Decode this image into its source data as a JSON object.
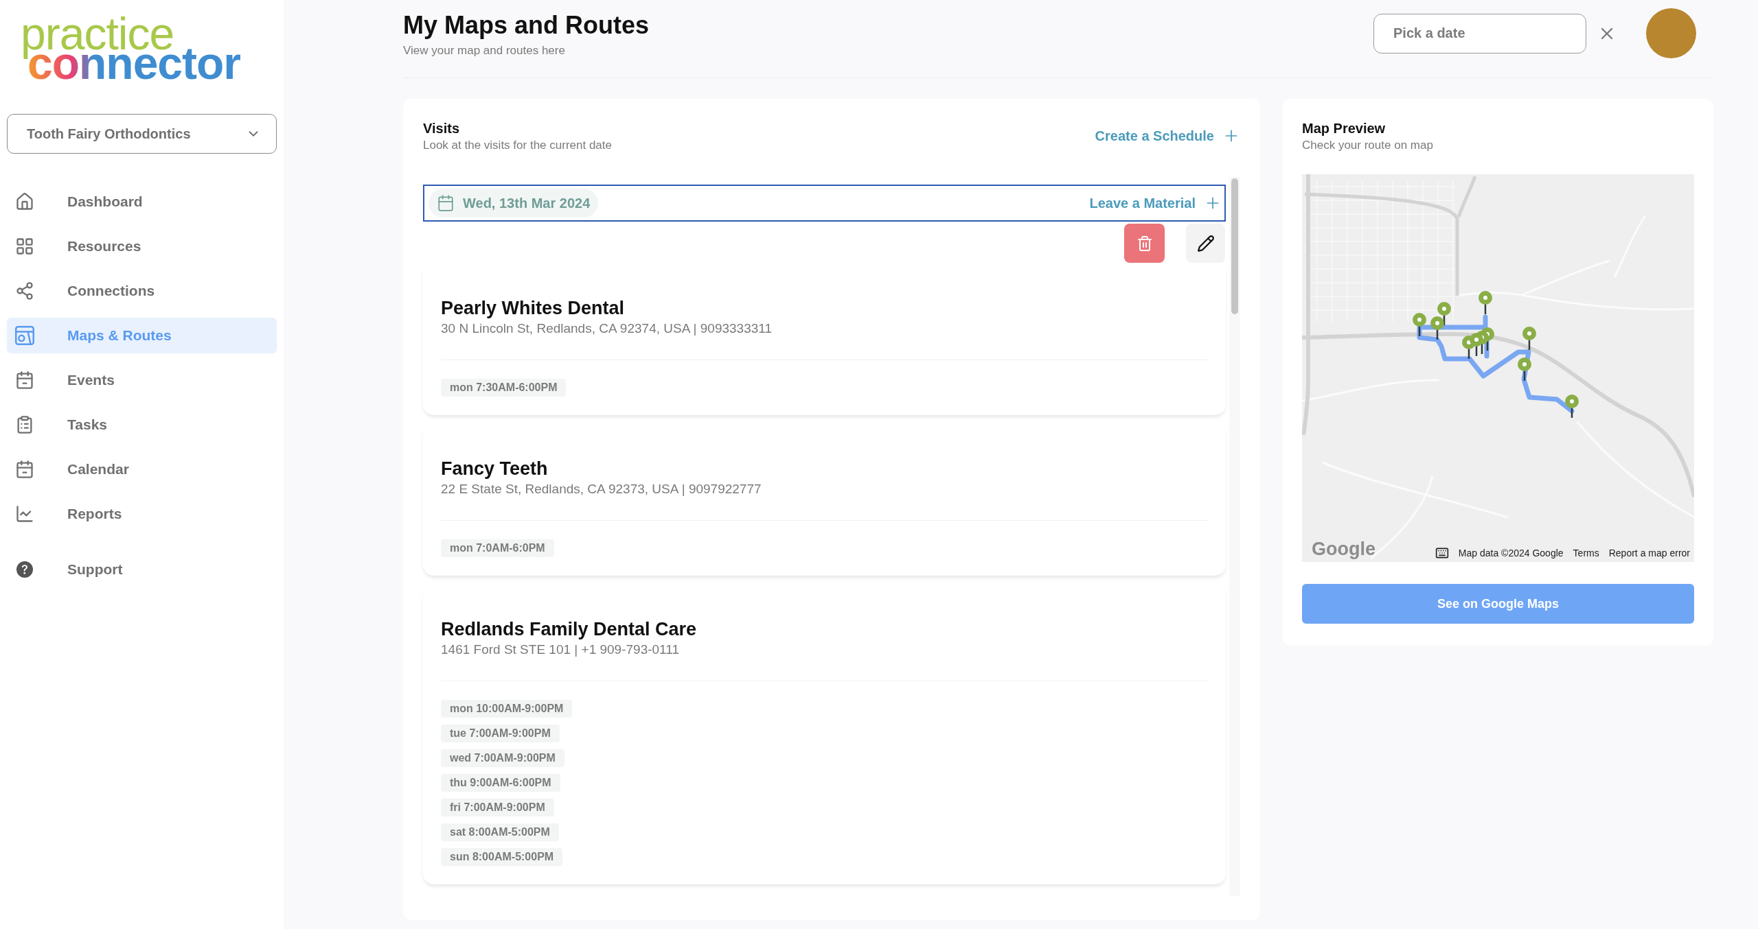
{
  "logo": {
    "line_1": "practice",
    "line_2": "connector"
  },
  "org_selector": {
    "value": "Tooth Fairy Orthodontics"
  },
  "nav": {
    "items": [
      {
        "label": "Dashboard",
        "selected": false
      },
      {
        "label": "Resources",
        "selected": false
      },
      {
        "label": "Connections",
        "selected": false
      },
      {
        "label": "Maps & Routes",
        "selected": true
      },
      {
        "label": "Events",
        "selected": false
      },
      {
        "label": "Tasks",
        "selected": false
      },
      {
        "label": "Calendar",
        "selected": false
      },
      {
        "label": "Reports",
        "selected": false
      }
    ],
    "footer_item": {
      "label": "Support",
      "selected": false
    }
  },
  "header": {
    "title": "My Maps and Routes",
    "subtitle": "View your map and routes here",
    "date_field": {
      "placeholder": "Pick a date"
    }
  },
  "visits": {
    "title": "Visits",
    "subtitle": "Look at the visits for the current date",
    "action": "Create a Schedule",
    "day": {
      "date": "Wed, 13th Mar 2024",
      "action": "Leave a Material",
      "selected": true
    },
    "places": [
      {
        "name": "Pearly Whites Dental",
        "address": "30 N Lincoln St, Redlands, CA 92374, USA | 9093333311",
        "hours": [
          "mon 7:30AM-6:00PM"
        ]
      },
      {
        "name": "Fancy Teeth",
        "address": "22 E State St, Redlands, CA 92373, USA | 9097922777",
        "hours": [
          "mon 7:0AM-6:0PM"
        ]
      },
      {
        "name": "Redlands Family Dental Care",
        "address": "1461 Ford St STE 101 | +1 909-793-0111",
        "hours": [
          "mon 10:00AM-9:00PM",
          "tue 7:00AM-9:00PM",
          "wed 7:00AM-9:00PM",
          "thu 9:00AM-6:00PM",
          "fri 7:00AM-9:00PM",
          "sat 8:00AM-5:00PM",
          "sun 8:00AM-5:00PM"
        ]
      }
    ]
  },
  "map_preview": {
    "title": "Map Preview",
    "subtitle": "Check your route on map",
    "map": {
      "logo": "Google",
      "attribution": "Map data ©2024 Google",
      "links": [
        "Terms",
        "Report a map error"
      ]
    },
    "button": "See on Google Maps"
  }
}
